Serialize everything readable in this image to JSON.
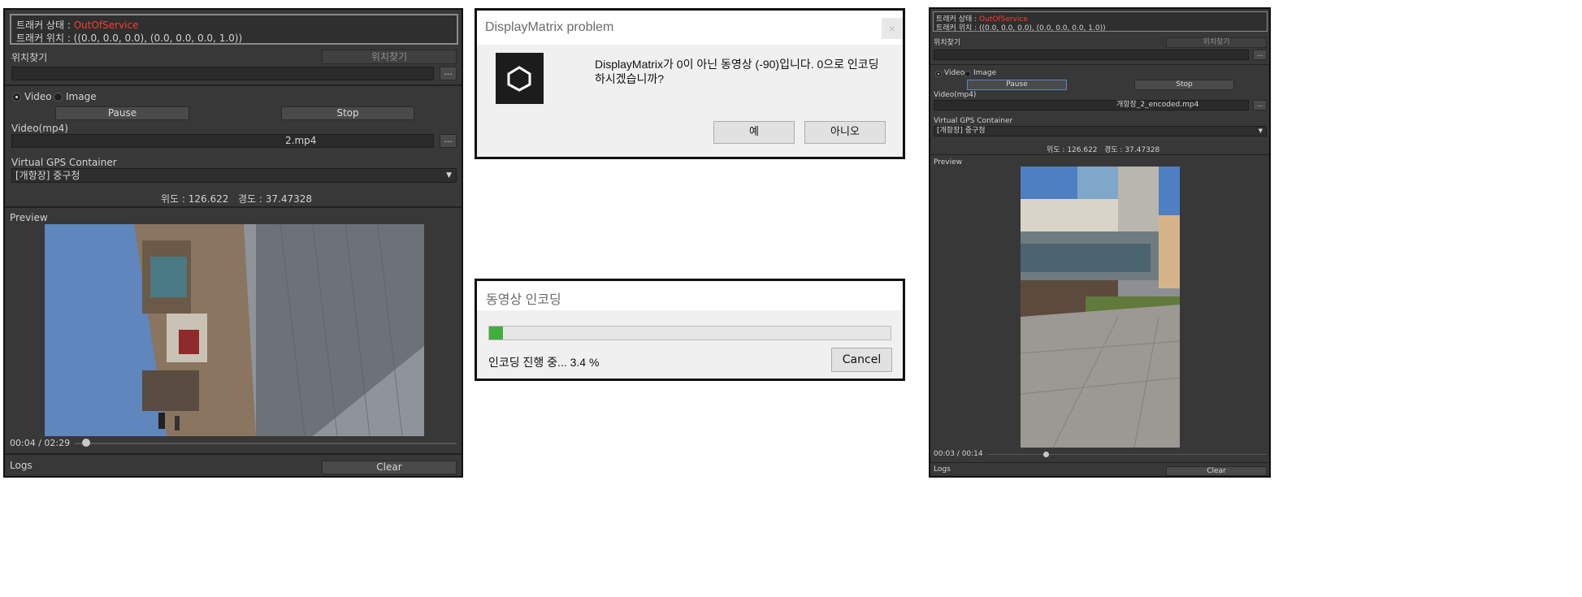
{
  "left_panel": {
    "tracker_status_label": "트래커 상태 :",
    "tracker_status_value": "OutOfService",
    "tracker_position": "트래커 위치 : ((0.0, 0.0, 0.0), (0.0, 0.0, 0.0, 1.0))",
    "find_location_label": "위치찾기",
    "find_location_button": "위치찾기",
    "browse_button": "...",
    "radio_video": "Video",
    "radio_image": "Image",
    "pause_button": "Pause",
    "stop_button": "Stop",
    "video_label": "Video(mp4)",
    "video_value": "2.mp4",
    "gps_label": "Virtual GPS Container",
    "gps_value": "[개항장] 중구청",
    "latitude": "위도 : 126.622",
    "longitude": "경도 : 37.47328",
    "preview_label": "Preview",
    "time": "00:04 / 02:29",
    "progress": 0.03,
    "logs_label": "Logs",
    "clear_button": "Clear"
  },
  "dialog_display_matrix": {
    "title": "DisplayMatrix problem",
    "message_line1": "DisplayMatrix가 0이 아닌 동영상 (-90)입니다. 0으로 인코딩",
    "message_line2": "하시겠습니까?",
    "yes_button": "예",
    "no_button": "아니오"
  },
  "dialog_encoding": {
    "title": "동영상 인코딩",
    "status": "인코딩 진행 중... 3.4 %",
    "progress": 0.034,
    "cancel_button": "Cancel"
  },
  "right_panel": {
    "tracker_status_label": "트래커 상태 :",
    "tracker_status_value": "OutOfService",
    "tracker_position": "트래커 위치 : ((0.0, 0.0, 0.0), (0.0, 0.0, 0.0, 1.0))",
    "find_location_label": "위치찾기",
    "find_location_button": "위치찾기",
    "browse_button": "...",
    "radio_video": "Video",
    "radio_image": "Image",
    "pause_button": "Pause",
    "stop_button": "Stop",
    "video_label": "Video(mp4)",
    "video_value": "개항장_2_encoded.mp4",
    "gps_label": "Virtual GPS Container",
    "gps_value": "[개항장] 중구청",
    "latitude": "위도 : 126.622",
    "longitude": "경도 : 37.47328",
    "preview_label": "Preview",
    "time": "00:03 / 00:14",
    "progress": 0.21,
    "logs_label": "Logs",
    "clear_button": "Clear"
  },
  "colors": {
    "panel_bg": "#383838",
    "status_red": "#ff3b30",
    "progress_green": "#3fae3f",
    "unity_logo_bg": "#1c1c1c"
  }
}
